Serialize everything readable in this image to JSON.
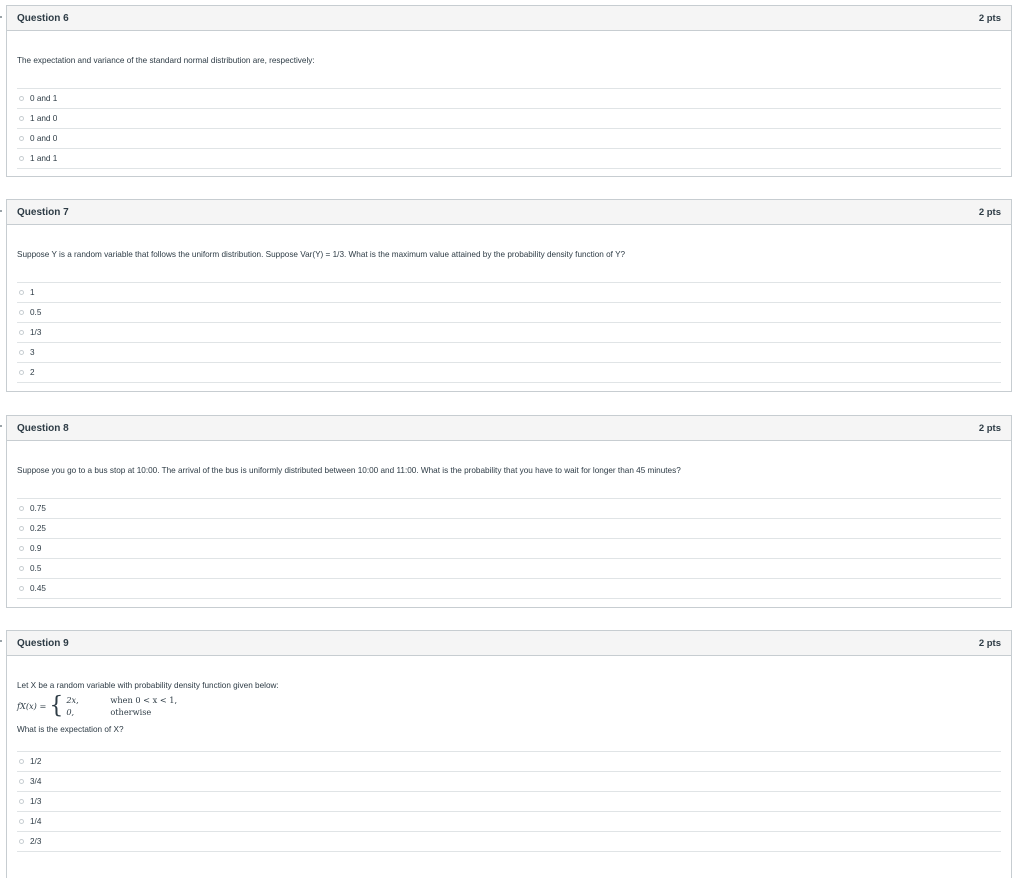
{
  "questions": [
    {
      "title": "Question 6",
      "points": "2 pts",
      "text": "The expectation and variance of the standard normal distribution are, respectively:",
      "answers": [
        "0 and 1",
        "1 and 0",
        "0 and 0",
        "1 and 1"
      ]
    },
    {
      "title": "Question 7",
      "points": "2 pts",
      "text": "Suppose Y is a random variable that follows the uniform distribution. Suppose Var(Y) = 1/3. What is the maximum value attained by the probability density function of Y?",
      "answers": [
        "1",
        "0.5",
        "1/3",
        "3",
        "2"
      ]
    },
    {
      "title": "Question 8",
      "points": "2 pts",
      "text": "Suppose you go to a bus stop at 10:00. The arrival of the bus is uniformly distributed between 10:00 and 11:00. What is the probability that you have to wait for longer than 45 minutes?",
      "answers": [
        "0.75",
        "0.25",
        "0.9",
        "0.5",
        "0.45"
      ]
    },
    {
      "title": "Question 9",
      "points": "2 pts",
      "text": "Let X be a random variable with probability density function given below:",
      "formula": {
        "lhs": "fX(x) =",
        "case1_value": "2x,",
        "case1_cond": "when 0 < x < 1,",
        "case2_value": "0,",
        "case2_cond": "otherwise"
      },
      "followup": "What is the expectation of X?",
      "answers": [
        "1/2",
        "3/4",
        "1/3",
        "1/4",
        "2/3"
      ]
    }
  ]
}
